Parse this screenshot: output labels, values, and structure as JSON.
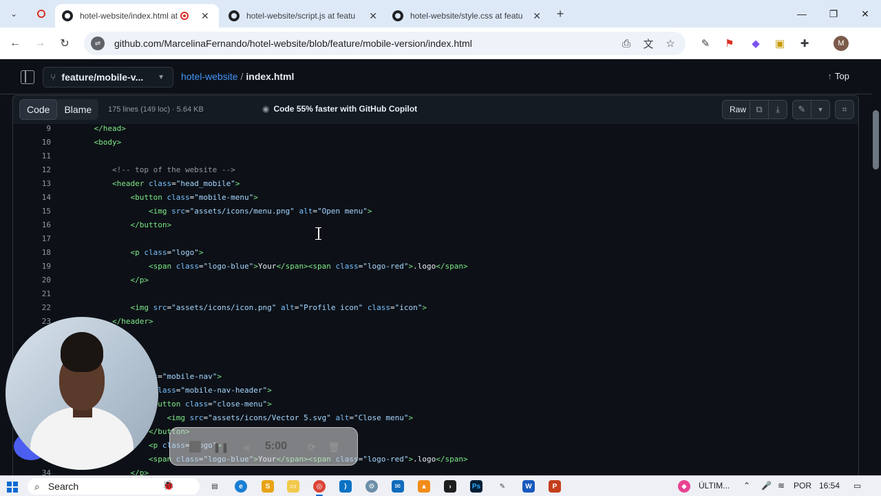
{
  "browser": {
    "tabs": [
      {
        "title": "hotel-website/index.html at"
      },
      {
        "title": "hotel-website/script.js at featu"
      },
      {
        "title": "hotel-website/style.css at featu"
      }
    ],
    "new_tab_symbol": "+",
    "url": "github.com/MarcelinaFernando/hotel-website/blob/feature/mobile-version/index.html",
    "profile_initial": "M"
  },
  "github": {
    "branch": "feature/mobile-v...",
    "repo": "hotel-website",
    "separator": "/",
    "file": "index.html",
    "top_label": "Top",
    "code_tab": "Code",
    "blame_tab": "Blame",
    "file_meta": "175 lines (149 loc) · 5.64 KB",
    "copilot_promo": "Code 55% faster with GitHub Copilot",
    "raw_label": "Raw"
  },
  "code_lines": [
    {
      "n": "9",
      "parts": [
        [
          "tag",
          "    </head>"
        ]
      ]
    },
    {
      "n": "10",
      "parts": [
        [
          "tag",
          "    <body>"
        ]
      ]
    },
    {
      "n": "11",
      "parts": []
    },
    {
      "n": "12",
      "parts": [
        [
          "cmt",
          "        <!-- top of the website -->"
        ]
      ]
    },
    {
      "n": "13",
      "parts": [
        [
          "tag",
          "        <header "
        ],
        [
          "attr",
          "class"
        ],
        [
          "txt",
          "="
        ],
        [
          "str",
          "\"head_mobile\""
        ],
        [
          "tag",
          ">"
        ]
      ]
    },
    {
      "n": "14",
      "parts": [
        [
          "tag",
          "            <button "
        ],
        [
          "attr",
          "class"
        ],
        [
          "txt",
          "="
        ],
        [
          "str",
          "\"mobile-menu\""
        ],
        [
          "tag",
          ">"
        ]
      ]
    },
    {
      "n": "15",
      "parts": [
        [
          "tag",
          "                <img "
        ],
        [
          "attr",
          "src"
        ],
        [
          "txt",
          "="
        ],
        [
          "str",
          "\"assets/icons/menu.png\""
        ],
        [
          "txt",
          " "
        ],
        [
          "attr",
          "alt"
        ],
        [
          "txt",
          "="
        ],
        [
          "str",
          "\"Open menu\""
        ],
        [
          "tag",
          ">"
        ]
      ]
    },
    {
      "n": "16",
      "parts": [
        [
          "tag",
          "            </button>"
        ]
      ]
    },
    {
      "n": "17",
      "parts": []
    },
    {
      "n": "18",
      "parts": [
        [
          "tag",
          "            <p "
        ],
        [
          "attr",
          "class"
        ],
        [
          "txt",
          "="
        ],
        [
          "str",
          "\"logo\""
        ],
        [
          "tag",
          ">"
        ]
      ]
    },
    {
      "n": "19",
      "parts": [
        [
          "tag",
          "                <span "
        ],
        [
          "attr",
          "class"
        ],
        [
          "txt",
          "="
        ],
        [
          "str",
          "\"logo-blue\""
        ],
        [
          "tag",
          ">"
        ],
        [
          "txt",
          "Your"
        ],
        [
          "tag",
          "</span><span "
        ],
        [
          "attr",
          "class"
        ],
        [
          "txt",
          "="
        ],
        [
          "str",
          "\"logo-red\""
        ],
        [
          "tag",
          ">"
        ],
        [
          "txt",
          ".logo"
        ],
        [
          "tag",
          "</span>"
        ]
      ]
    },
    {
      "n": "20",
      "parts": [
        [
          "tag",
          "            </p>"
        ]
      ]
    },
    {
      "n": "21",
      "parts": []
    },
    {
      "n": "22",
      "parts": [
        [
          "tag",
          "            <img "
        ],
        [
          "attr",
          "src"
        ],
        [
          "txt",
          "="
        ],
        [
          "str",
          "\"assets/icons/icon.png\""
        ],
        [
          "txt",
          " "
        ],
        [
          "attr",
          "alt"
        ],
        [
          "txt",
          "="
        ],
        [
          "str",
          "\"Profile icon\""
        ],
        [
          "txt",
          " "
        ],
        [
          "attr",
          "class"
        ],
        [
          "txt",
          "="
        ],
        [
          "str",
          "\"icon\""
        ],
        [
          "tag",
          ">"
        ]
      ]
    },
    {
      "n": "23",
      "parts": [
        [
          "tag",
          "        </header>"
        ]
      ]
    },
    {
      "n": "",
      "parts": []
    },
    {
      "n": "",
      "parts": []
    },
    {
      "n": "",
      "parts": [
        [
          "cmt",
          "        <!-- -->"
        ]
      ]
    },
    {
      "n": "",
      "parts": [
        [
          "tag",
          "        <nav "
        ],
        [
          "attr",
          "class"
        ],
        [
          "txt",
          "="
        ],
        [
          "str",
          "\"mobile-nav\""
        ],
        [
          "tag",
          ">"
        ]
      ]
    },
    {
      "n": "",
      "parts": [
        [
          "tag",
          "            <div "
        ],
        [
          "attr",
          "class"
        ],
        [
          "txt",
          "="
        ],
        [
          "str",
          "\"mobile-nav-header\""
        ],
        [
          "tag",
          ">"
        ]
      ]
    },
    {
      "n": "",
      "parts": [
        [
          "tag",
          "                <button "
        ],
        [
          "attr",
          "class"
        ],
        [
          "txt",
          "="
        ],
        [
          "str",
          "\"close-menu\""
        ],
        [
          "tag",
          ">"
        ]
      ]
    },
    {
      "n": "",
      "parts": [
        [
          "tag",
          "                    <img "
        ],
        [
          "attr",
          "src"
        ],
        [
          "txt",
          "="
        ],
        [
          "str",
          "\"assets/icons/Vector 5.svg\""
        ],
        [
          "txt",
          " "
        ],
        [
          "attr",
          "alt"
        ],
        [
          "txt",
          "="
        ],
        [
          "str",
          "\"Close menu\""
        ],
        [
          "tag",
          ">"
        ]
      ]
    },
    {
      "n": "",
      "parts": [
        [
          "tag",
          "                </button>"
        ]
      ]
    },
    {
      "n": "",
      "parts": [
        [
          "tag",
          "                <p "
        ],
        [
          "attr",
          "class"
        ],
        [
          "txt",
          "="
        ],
        [
          "str",
          "\"logo\""
        ],
        [
          "tag",
          ">"
        ]
      ]
    },
    {
      "n": "",
      "parts": [
        [
          "tag",
          "                <span "
        ],
        [
          "attr",
          "class"
        ],
        [
          "txt",
          "="
        ],
        [
          "str",
          "\"logo-blue\""
        ],
        [
          "tag",
          ">"
        ],
        [
          "txt",
          "Your"
        ],
        [
          "tag",
          "</span><span "
        ],
        [
          "attr",
          "class"
        ],
        [
          "txt",
          "="
        ],
        [
          "str",
          "\"logo-red\""
        ],
        [
          "tag",
          ">"
        ],
        [
          "txt",
          ".logo"
        ],
        [
          "tag",
          "</span>"
        ]
      ]
    },
    {
      "n": "34",
      "parts": [
        [
          "tag",
          "            </p>"
        ]
      ]
    }
  ],
  "recorder": {
    "time": "5:00"
  },
  "taskbar": {
    "search_label": "Search",
    "tray_app": "ÚLTIM...",
    "language": "POR",
    "time": "16:54"
  }
}
